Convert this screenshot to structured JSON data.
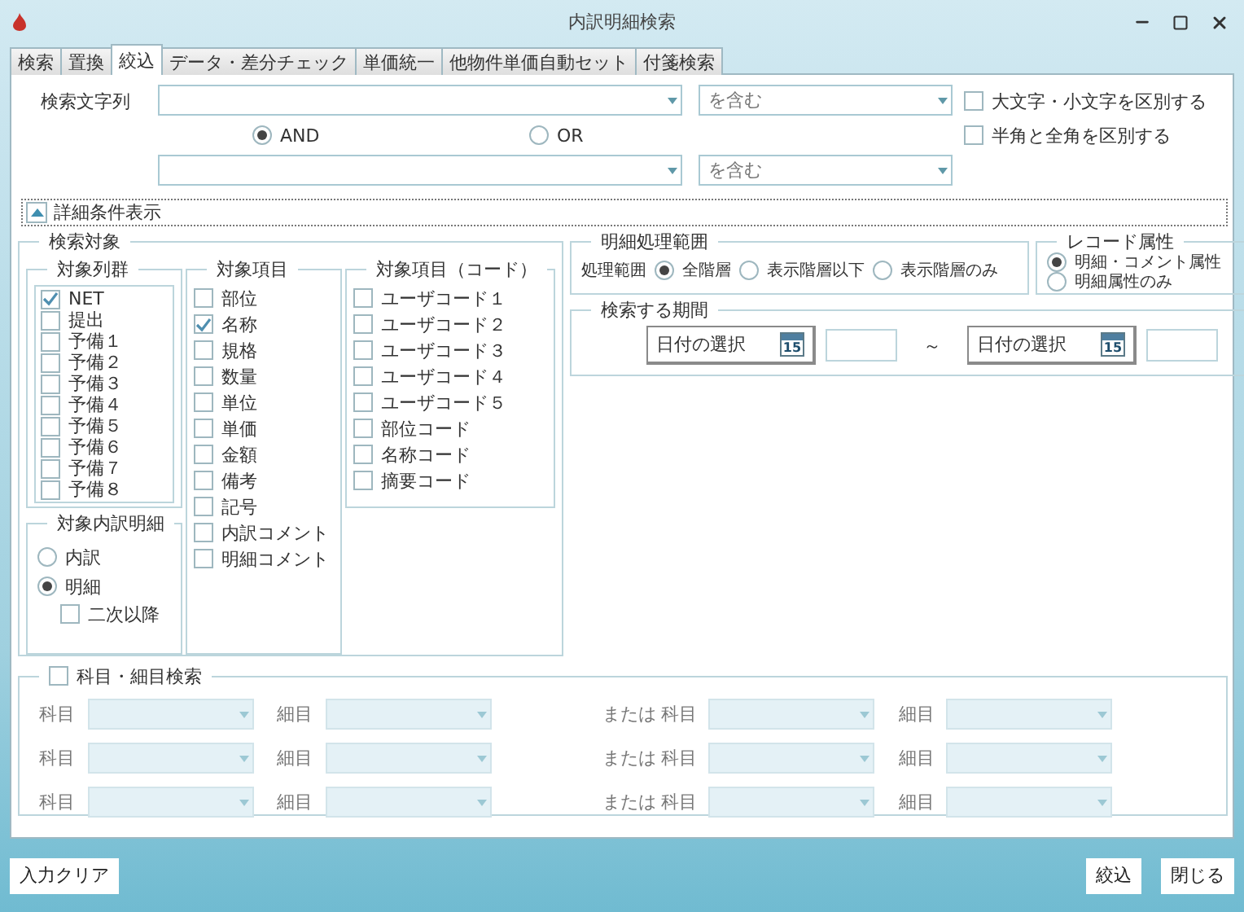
{
  "window": {
    "title": "内訳明細検索"
  },
  "tabs": [
    {
      "label": "検索",
      "selected": false
    },
    {
      "label": "置換",
      "selected": false
    },
    {
      "label": "絞込",
      "selected": true
    },
    {
      "label": "データ・差分チェック",
      "selected": false
    },
    {
      "label": "単価統一",
      "selected": false
    },
    {
      "label": "他物件単価自動セット",
      "selected": false
    },
    {
      "label": "付箋検索",
      "selected": false
    }
  ],
  "search": {
    "label": "検索文字列",
    "fields": [
      {
        "match": "を含む"
      },
      {
        "match": "を含む"
      }
    ],
    "operators": [
      {
        "label": "AND",
        "selected": true
      },
      {
        "label": "OR",
        "selected": false
      }
    ],
    "options": [
      {
        "label": "大文字・小文字を区別する",
        "checked": false
      },
      {
        "label": "半角と全角を区別する",
        "checked": false
      }
    ]
  },
  "details_toggle": {
    "label": "詳細条件表示",
    "expanded": true
  },
  "search_target": {
    "title": "検索対象",
    "column_groups": {
      "title": "対象列群",
      "items": [
        {
          "label": "NET",
          "checked": true
        },
        {
          "label": "提出",
          "checked": false
        },
        {
          "label": "予備１",
          "checked": false
        },
        {
          "label": "予備２",
          "checked": false
        },
        {
          "label": "予備３",
          "checked": false
        },
        {
          "label": "予備４",
          "checked": false
        },
        {
          "label": "予備５",
          "checked": false
        },
        {
          "label": "予備６",
          "checked": false
        },
        {
          "label": "予備７",
          "checked": false
        },
        {
          "label": "予備８",
          "checked": false
        }
      ]
    },
    "items": {
      "title": "対象項目",
      "items": [
        {
          "label": "部位",
          "checked": false
        },
        {
          "label": "名称",
          "checked": true
        },
        {
          "label": "規格",
          "checked": false
        },
        {
          "label": "数量",
          "checked": false
        },
        {
          "label": "単位",
          "checked": false
        },
        {
          "label": "単価",
          "checked": false
        },
        {
          "label": "金額",
          "checked": false
        },
        {
          "label": "備考",
          "checked": false
        },
        {
          "label": "記号",
          "checked": false
        },
        {
          "label": "内訳コメント",
          "checked": false
        },
        {
          "label": "明細コメント",
          "checked": false
        }
      ]
    },
    "code_items": {
      "title": "対象項目（コード）",
      "items": [
        {
          "label": "ユーザコード１",
          "checked": false
        },
        {
          "label": "ユーザコード２",
          "checked": false
        },
        {
          "label": "ユーザコード３",
          "checked": false
        },
        {
          "label": "ユーザコード４",
          "checked": false
        },
        {
          "label": "ユーザコード５",
          "checked": false
        },
        {
          "label": "部位コード",
          "checked": false
        },
        {
          "label": "名称コード",
          "checked": false
        },
        {
          "label": "摘要コード",
          "checked": false
        }
      ]
    },
    "breakdown": {
      "title": "対象内訳明細",
      "options": [
        {
          "label": "内訳",
          "selected": false
        },
        {
          "label": "明細",
          "selected": true
        }
      ],
      "secondary": {
        "label": "二次以降",
        "checked": false
      }
    }
  },
  "scope": {
    "title": "明細処理範囲",
    "label": "処理範囲",
    "options": [
      {
        "label": "全階層",
        "selected": true
      },
      {
        "label": "表示階層以下",
        "selected": false
      },
      {
        "label": "表示階層のみ",
        "selected": false
      }
    ]
  },
  "record": {
    "title": "レコード属性",
    "options": [
      {
        "label": "明細・コメント属性",
        "selected": true
      },
      {
        "label": "明細属性のみ",
        "selected": false
      }
    ]
  },
  "period": {
    "title": "検索する期間",
    "from": {
      "placeholder": "日付の選択",
      "calendar_day": "15"
    },
    "separator": "～",
    "to": {
      "placeholder": "日付の選択",
      "calendar_day": "15"
    }
  },
  "subject_search": {
    "label": "科目・細目検索",
    "checked": false,
    "rows": [
      {
        "subject": "科目",
        "detail": "細目",
        "or": "または",
        "subject_2": "科目",
        "detail_2": "細目"
      },
      {
        "subject": "科目",
        "detail": "細目",
        "or": "または",
        "subject_2": "科目",
        "detail_2": "細目"
      },
      {
        "subject": "科目",
        "detail": "細目",
        "or": "または",
        "subject_2": "科目",
        "detail_2": "細目"
      }
    ]
  },
  "footer": {
    "left": [
      "入力クリア"
    ],
    "right": [
      "絞込",
      "閉じる"
    ]
  }
}
